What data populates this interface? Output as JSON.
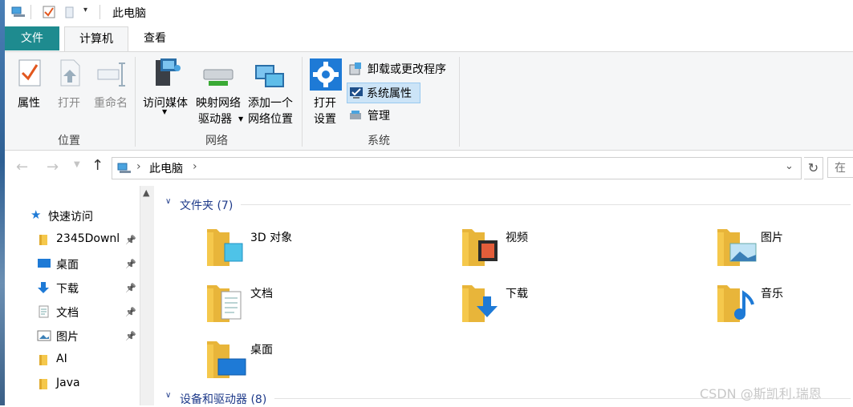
{
  "title_bar": {
    "title": "此电脑"
  },
  "tabs": {
    "file": "文件",
    "computer": "计算机",
    "view": "查看"
  },
  "ribbon": {
    "location_group": {
      "label": "位置",
      "properties": "属性",
      "open": "打开",
      "rename": "重命名"
    },
    "network_group": {
      "label": "网络",
      "access_media": "访问媒体",
      "map_drive_1": "映射网络",
      "map_drive_2": "驱动器",
      "add_location_1": "添加一个",
      "add_location_2": "网络位置"
    },
    "system_group": {
      "label": "系统",
      "open_settings_1": "打开",
      "open_settings_2": "设置",
      "uninstall": "卸载或更改程序",
      "system_properties": "系统属性",
      "manage": "管理"
    }
  },
  "address": {
    "crumb": "此电脑",
    "search_placeholder": "在"
  },
  "nav": {
    "quick_access": "快速访问",
    "items": [
      {
        "label": "2345Downl",
        "icon": "folder-icon",
        "pinned": true
      },
      {
        "label": "桌面",
        "icon": "desktop-icon",
        "pinned": true
      },
      {
        "label": "下载",
        "icon": "download-icon",
        "pinned": true
      },
      {
        "label": "文档",
        "icon": "document-icon",
        "pinned": true
      },
      {
        "label": "图片",
        "icon": "picture-icon",
        "pinned": true
      },
      {
        "label": "AI",
        "icon": "folder-icon",
        "pinned": false
      },
      {
        "label": "Java",
        "icon": "folder-icon",
        "pinned": false
      }
    ]
  },
  "content": {
    "folders_header": "文件夹 (7)",
    "folders": [
      {
        "name": "3D 对象",
        "icon": "3d-objects-icon"
      },
      {
        "name": "视频",
        "icon": "video-icon"
      },
      {
        "name": "图片",
        "icon": "picture-icon"
      },
      {
        "name": "文档",
        "icon": "document-icon"
      },
      {
        "name": "下载",
        "icon": "download-icon"
      },
      {
        "name": "音乐",
        "icon": "music-icon"
      },
      {
        "name": "桌面",
        "icon": "desktop-icon"
      }
    ],
    "devices_header": "设备和驱动器 (8)"
  },
  "watermark": "CSDN @斯凯利.瑞恩",
  "colors": {
    "file_tab": "#1e8b8f",
    "accent_blue": "#1e3a8a",
    "folder": "#f5c84c"
  }
}
